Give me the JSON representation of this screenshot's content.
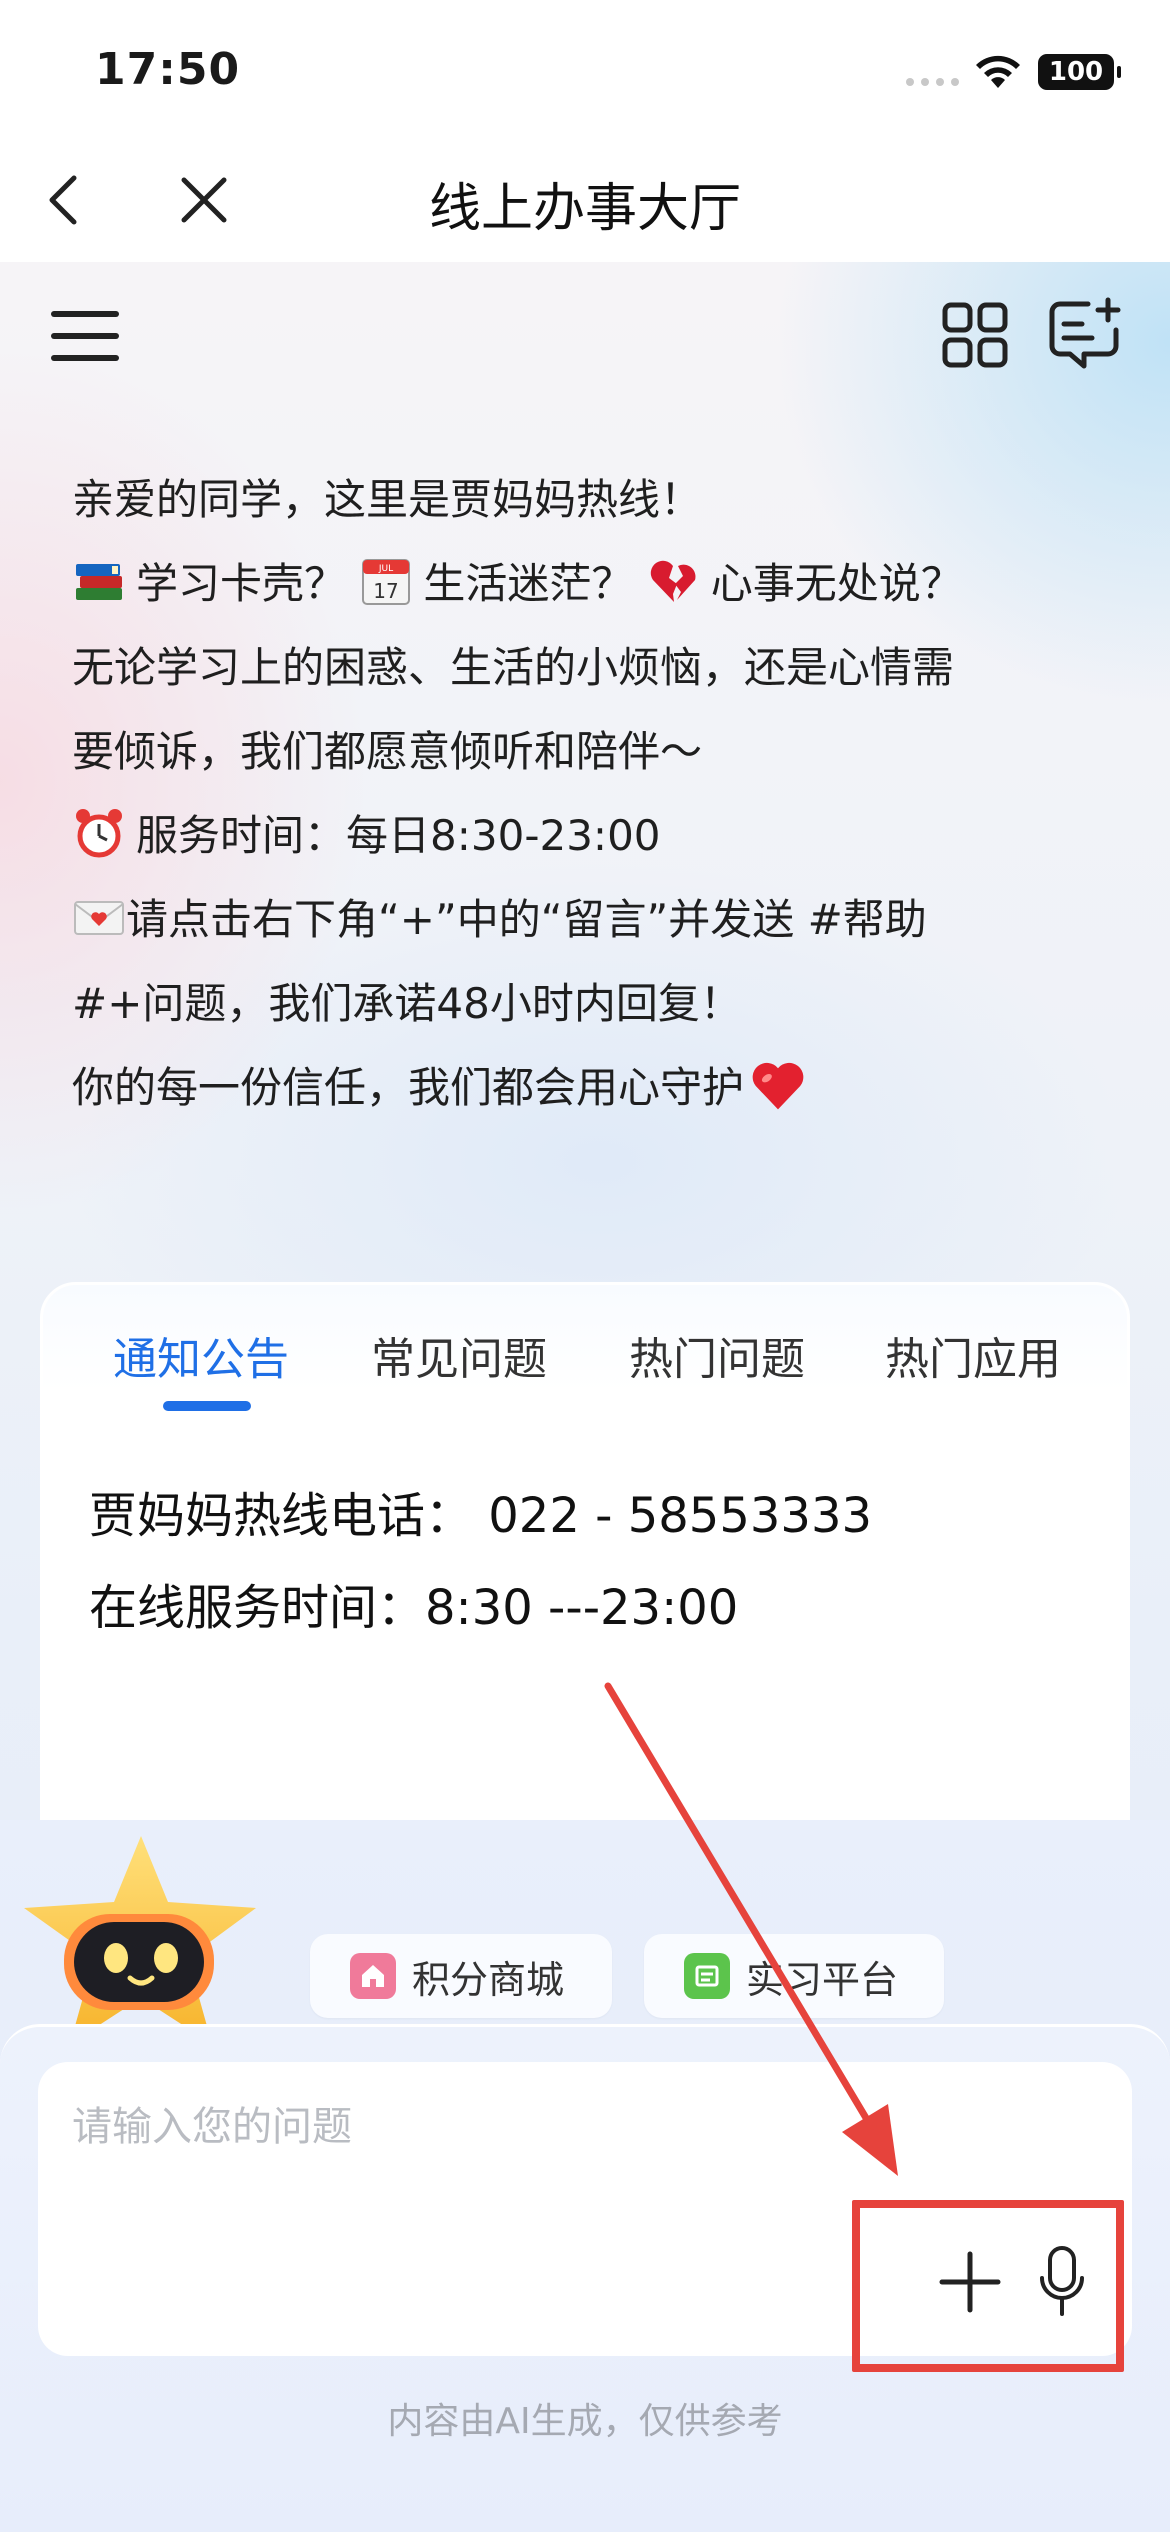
{
  "status_bar": {
    "time": "17:50",
    "battery": "100"
  },
  "nav": {
    "title": "线上办事大厅"
  },
  "welcome": {
    "line1": "亲爱的同学，这里是贾妈妈热线！",
    "line2": "学习卡壳？",
    "line2b": "生活迷茫？",
    "line2c": "心事无处说？",
    "line3": "无论学习上的困惑、生活的小烦恼，还是心情需",
    "line4": "要倾诉，我们都愿意倾听和陪伴～",
    "line5": "服务时间：每日8:30-23:00",
    "line6": "请点击右下角“+”中的“留言”并发送 #帮助",
    "line7": "#+问题，我们承诺48小时内回复！",
    "line8": "你的每一份信任，我们都会用心守护",
    "calendar_month": "JUL",
    "calendar_day": "17"
  },
  "tabs": [
    {
      "label": "通知公告",
      "active": true
    },
    {
      "label": "常见问题",
      "active": false
    },
    {
      "label": "热门问题",
      "active": false
    },
    {
      "label": "热门应用",
      "active": false
    }
  ],
  "notice": {
    "hotline": "贾妈妈热线电话：  022 - 58553333",
    "hours": "在线服务时间：8:30 ---23:00"
  },
  "chips": [
    {
      "label": "积分商城",
      "icon": "home-icon",
      "color": "#f07a9a"
    },
    {
      "label": "实习平台",
      "icon": "intern-icon",
      "color": "#5cc44c"
    }
  ],
  "input": {
    "placeholder": "请输入您的问题"
  },
  "disclaimer": "内容由AI生成，仅供参考",
  "colors": {
    "accent": "#1f6fe6",
    "annotation": "#e6433c"
  }
}
